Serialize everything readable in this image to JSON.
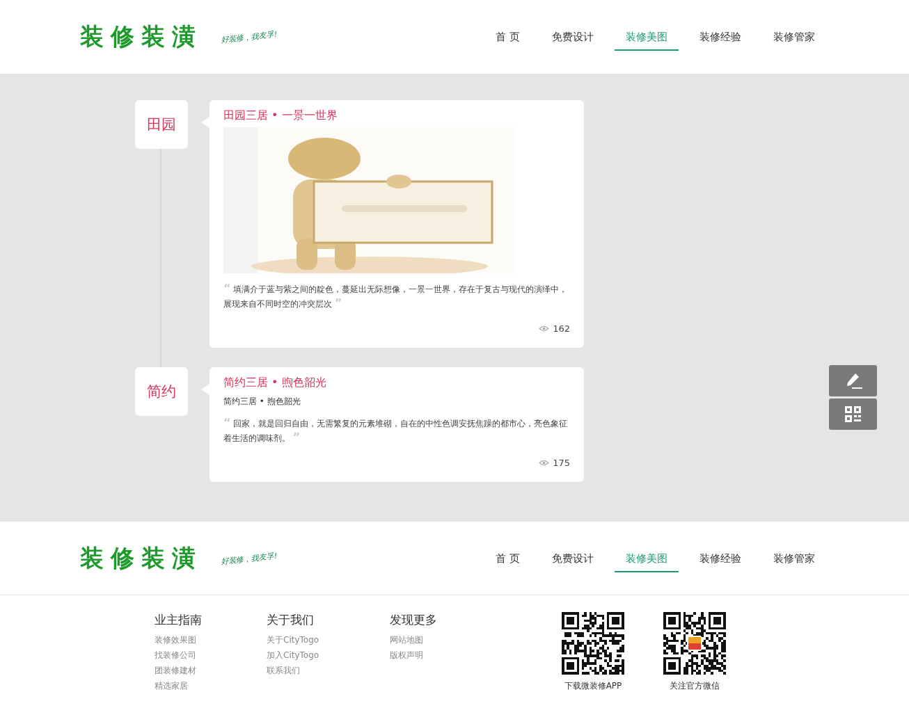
{
  "header": {
    "logo": "装修装潢",
    "slogan": "好装修，我友孚!",
    "nav": [
      {
        "label": "首 页",
        "selected": false
      },
      {
        "label": "免费设计",
        "selected": false
      },
      {
        "label": "装修美图",
        "selected": true
      },
      {
        "label": "装修经验",
        "selected": false
      },
      {
        "label": "装修管家",
        "selected": false
      }
    ]
  },
  "timeline": [
    {
      "tag": "田园",
      "title": "田园三居 • 一景一世界",
      "kind": "picture",
      "quote_open": "“",
      "description": "填满介于蓝与紫之间的靛色，蔓延出无际想像，一景一世界，存在于复古与现代的演绎中，展现来自不同时空的冲突层次",
      "quote_close": "”",
      "views": "162"
    },
    {
      "tag": "简约",
      "title": "简约三居 • 煦色韶光",
      "kind": "text",
      "subtitle": "简约三居 • 煦色韶光",
      "quote_open": "“",
      "description": "回家，就是回归自由，无需繁复的元素堆砌，自在的中性色调安抚焦躁的都市心，亮色象征着生活的调味剂。",
      "quote_close": "”",
      "views": "175"
    }
  ],
  "footer_header": {
    "logo": "装修装潢",
    "slogan": "好装修，我友孚!",
    "nav": [
      {
        "label": "首 页",
        "selected": false
      },
      {
        "label": "免费设计",
        "selected": false
      },
      {
        "label": "装修美图",
        "selected": true
      },
      {
        "label": "装修经验",
        "selected": false
      },
      {
        "label": "装修管家",
        "selected": false
      }
    ]
  },
  "footer": {
    "columns": [
      {
        "title": "业主指南",
        "links": [
          "装修效果图",
          "找装修公司",
          "团装修建材",
          "精选家居"
        ]
      },
      {
        "title": "关于我们",
        "links": [
          "关于CityTogo",
          "加入CityTogo",
          "联系我们"
        ]
      },
      {
        "title": "发现更多",
        "links": [
          "网站地图",
          "版权声明"
        ]
      }
    ],
    "qr_codes": [
      {
        "caption": "下载微装修APP",
        "center_logo": false
      },
      {
        "caption": "关注官方微信",
        "center_logo": true
      }
    ]
  }
}
